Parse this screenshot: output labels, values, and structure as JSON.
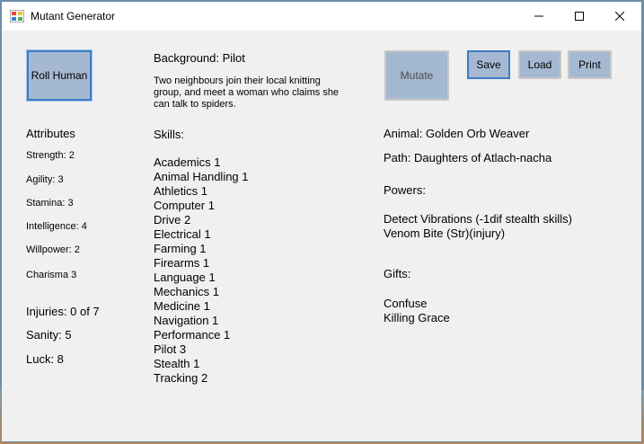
{
  "window": {
    "title": "Mutant Generator",
    "minimize_glyph": "—",
    "maximize_glyph": "☐",
    "close_glyph": "✕"
  },
  "buttons": {
    "roll_human": "Roll Human",
    "mutate": "Mutate",
    "save": "Save",
    "load": "Load",
    "print": "Print"
  },
  "background": {
    "title": "Background: Pilot",
    "description": "Two neighbours join their local knitting group, and meet a woman who claims she can talk to spiders."
  },
  "attributes": {
    "heading": "Attributes",
    "items": [
      "Strength: 2",
      "Agility: 3",
      "Stamina: 3",
      "Intelligence: 4",
      "Willpower: 2",
      "Charisma 3"
    ]
  },
  "status": {
    "injuries": "Injuries: 0 of 7",
    "sanity": "Sanity: 5",
    "luck": "Luck: 8"
  },
  "skills": {
    "heading": "Skills:",
    "items": [
      "Academics 1",
      "Animal Handling 1",
      "Athletics 1",
      "Computer 1",
      "Drive 2",
      "Electrical 1",
      "Farming 1",
      "Firearms 1",
      "Language 1",
      "Mechanics 1",
      "Medicine 1",
      "Navigation 1",
      "Performance 1",
      "Pilot 3",
      "Stealth 1",
      "Tracking 2"
    ]
  },
  "mutant": {
    "animal": "Animal: Golden Orb Weaver",
    "path": "Path: Daughters of Atlach-nacha",
    "powers_heading": "Powers:",
    "powers": [
      "Detect Vibrations (-1dif stealth skills)",
      "Venom Bite (Str)(injury)"
    ],
    "gifts_heading": "Gifts:",
    "gifts": [
      "Confuse",
      "Killing Grace"
    ]
  },
  "colors": {
    "button_face": "#a5b8d1",
    "focus_border": "#3d7bc8",
    "window_bg": "#f0f0f0"
  }
}
